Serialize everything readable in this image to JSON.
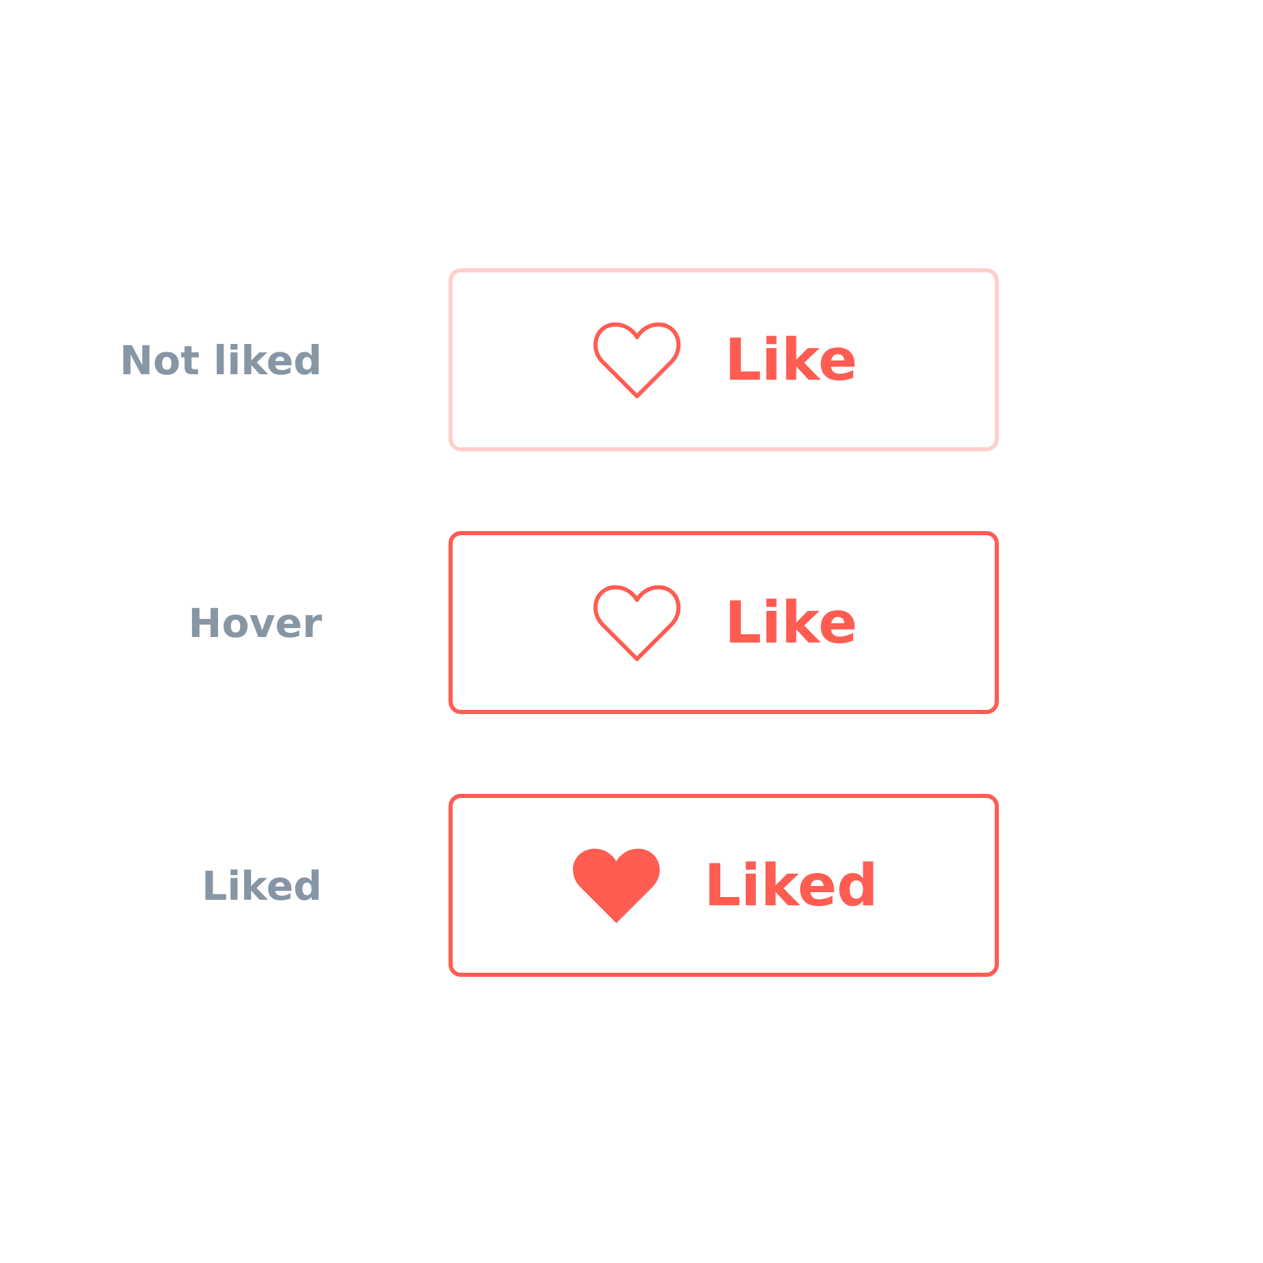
{
  "rows": [
    {
      "label": "Not liked",
      "button": {
        "kind": "rest",
        "text": "Like"
      }
    },
    {
      "label": "Hover",
      "button": {
        "kind": "hover",
        "text": "Like"
      }
    },
    {
      "label": "Liked",
      "button": {
        "kind": "liked",
        "text": "Liked"
      }
    }
  ]
}
